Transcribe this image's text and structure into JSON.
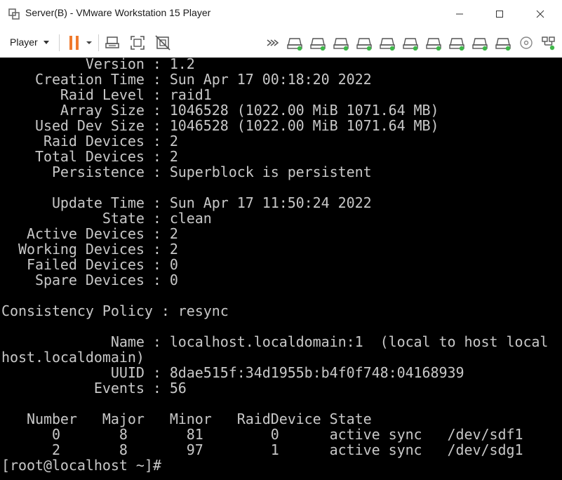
{
  "window": {
    "title": "Server(B) - VMware Workstation 15 Player"
  },
  "toolbar": {
    "player_label": "Player",
    "icons": [
      "pause-icon",
      "send-ctrl-alt-del-icon",
      "fit-guest-icon",
      "unity-icon",
      "more-devices-icon",
      "hard-disk-icon",
      "hard-disk-icon",
      "hard-disk-icon",
      "hard-disk-icon",
      "hard-disk-icon",
      "hard-disk-icon",
      "hard-disk-icon",
      "hard-disk-icon",
      "hard-disk-icon",
      "hard-disk-icon",
      "cd-dvd-icon",
      "network-adapter-icon"
    ]
  },
  "console": {
    "lines": [
      "          Version : 1.2",
      "    Creation Time : Sun Apr 17 00:18:20 2022",
      "       Raid Level : raid1",
      "       Array Size : 1046528 (1022.00 MiB 1071.64 MB)",
      "    Used Dev Size : 1046528 (1022.00 MiB 1071.64 MB)",
      "     Raid Devices : 2",
      "    Total Devices : 2",
      "      Persistence : Superblock is persistent",
      "",
      "      Update Time : Sun Apr 17 11:50:24 2022",
      "            State : clean",
      "   Active Devices : 2",
      "  Working Devices : 2",
      "   Failed Devices : 0",
      "    Spare Devices : 0",
      "",
      "Consistency Policy : resync",
      "",
      "             Name : localhost.localdomain:1  (local to host local",
      "host.localdomain)",
      "             UUID : 8dae515f:34d1955b:b4f0f748:04168939",
      "           Events : 56",
      "",
      "   Number   Major   Minor   RaidDevice State",
      "      0       8       81        0      active sync   /dev/sdf1",
      "      2       8       97        1      active sync   /dev/sdg1",
      "[root@localhost ~]#"
    ]
  }
}
